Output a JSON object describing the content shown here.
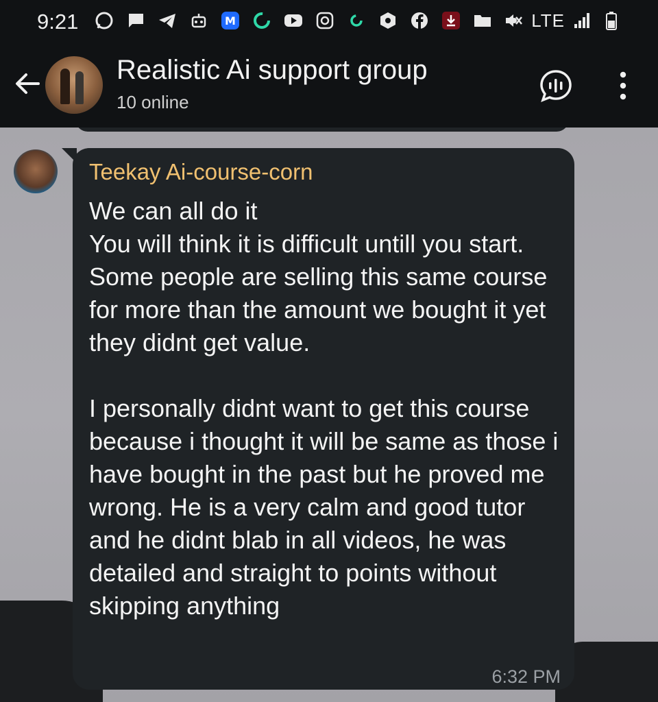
{
  "status_bar": {
    "time": "9:21",
    "network": "LTE",
    "icons_left": [
      "whatsapp-icon",
      "chat-icon",
      "telegram-icon",
      "bot-icon",
      "m-app-icon",
      "sync-icon",
      "youtube-icon",
      "instagram-icon",
      "sync-small-icon",
      "hexagon-icon",
      "facebook-icon",
      "download-icon",
      "folder-icon",
      "dot-icon"
    ],
    "icons_right": [
      "mute-icon",
      "signal-icon",
      "battery-icon"
    ]
  },
  "header": {
    "title": "Realistic Ai support group",
    "subtitle": "10 online",
    "icons": [
      "back-arrow-icon",
      "voice-chat-icon",
      "more-vert-icon"
    ]
  },
  "message": {
    "sender": "Teekay Ai-course-corn",
    "text": "We can all do it\nYou will think it is difficult untill you start. Some people are selling this same course for more than the amount we bought it yet they didnt get value.\n\nI personally didnt want to get this course because i thought it will be same as those i have bought in the past but he proved me wrong. He is a very calm and good tutor and he didnt blab in all videos, he was detailed and straight to points without skipping anything",
    "time": "6:32 PM"
  },
  "colors": {
    "bar_background": "#101214",
    "bubble_background": "#1f2326",
    "sender_name": "#f0c070",
    "chat_background": "#a9a8ad"
  }
}
